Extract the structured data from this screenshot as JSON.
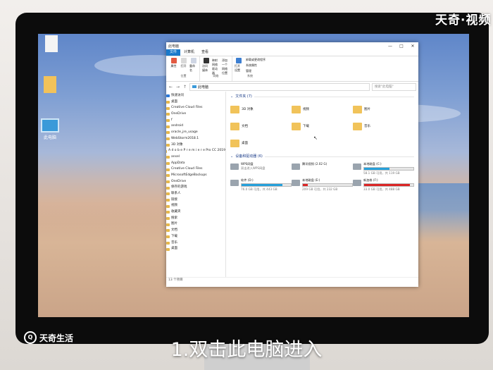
{
  "brand_top": "天奇·视频",
  "brand_bottom": {
    "icon": "magnifier-logo-icon",
    "text": "天奇生活"
  },
  "caption": "1.双击此电脑进入",
  "desktop_icons": [
    {
      "icon": "file-icon",
      "label": ""
    },
    {
      "icon": "folder-icon",
      "label": ""
    },
    {
      "icon": "computer-icon",
      "label": "此电脑"
    }
  ],
  "explorer": {
    "title": "此电脑",
    "window_buttons": [
      "—",
      "□",
      "✕"
    ],
    "ribbon_tabs": [
      "文件",
      "计算机",
      "查看"
    ],
    "ribbon_groups": [
      {
        "label": "位置",
        "buttons": [
          "属性",
          "打开",
          "重命名"
        ]
      },
      {
        "label": "网络",
        "buttons": [
          "访问媒体",
          "映射网络驱动器",
          "添加一个网络位置"
        ]
      },
      {
        "label": "系统",
        "buttons": [
          "打开设置"
        ],
        "list": [
          "卸载或更改程序",
          "系统属性",
          "管理"
        ]
      }
    ],
    "address": "此电脑",
    "search_placeholder": "搜索\"此电脑\"",
    "nav": [
      "快速访问",
      "桌面",
      "Creative Cloud Files",
      "OneDrive",
      "f",
      "android",
      "oracle_jre_usage",
      "WebStorm2018.1",
      "3D 对象",
      "A d o b e P r e m i e r e Pro CC 2019",
      "ansel",
      "AppData",
      "Creative Cloud Files",
      "MicrosoftEdgeBackups",
      "OneDrive",
      "保存的游戏",
      "联系人",
      "链接",
      "视频",
      "收藏夹",
      "搜索",
      "图片",
      "文档",
      "下载",
      "音乐",
      "桌面"
    ],
    "folders_header": "文件夹 (7)",
    "folders": [
      "3D 对象",
      "视频",
      "图片",
      "文档",
      "下载",
      "音乐",
      "桌面"
    ],
    "drives_header": "设备和驱动器 (6)",
    "drives": [
      {
        "name": "WPS网盘",
        "size": "双击进入WPS网盘",
        "bar": null
      },
      {
        "name": "腾讯视频 (2.02 G)",
        "size": "",
        "bar": null
      },
      {
        "name": "本地磁盘 (C:)",
        "size": "58.1 GB 可用，共 119 GB",
        "bar": 0.51,
        "color": "#26a0da"
      },
      {
        "name": "软件 (D:)",
        "size": "76.0 GB 可用，共 443 GB",
        "bar": 0.83,
        "color": "#26a0da"
      },
      {
        "name": "本地磁盘 (E:)",
        "size": "209 GB 可用，共 232 GB",
        "bar": 0.1,
        "color": "#da2626"
      },
      {
        "name": "新加卷 (F:)",
        "size": "33.0 GB 可用，共 488 GB",
        "bar": 0.93,
        "color": "#da2626"
      }
    ],
    "status": "13 个项目"
  }
}
